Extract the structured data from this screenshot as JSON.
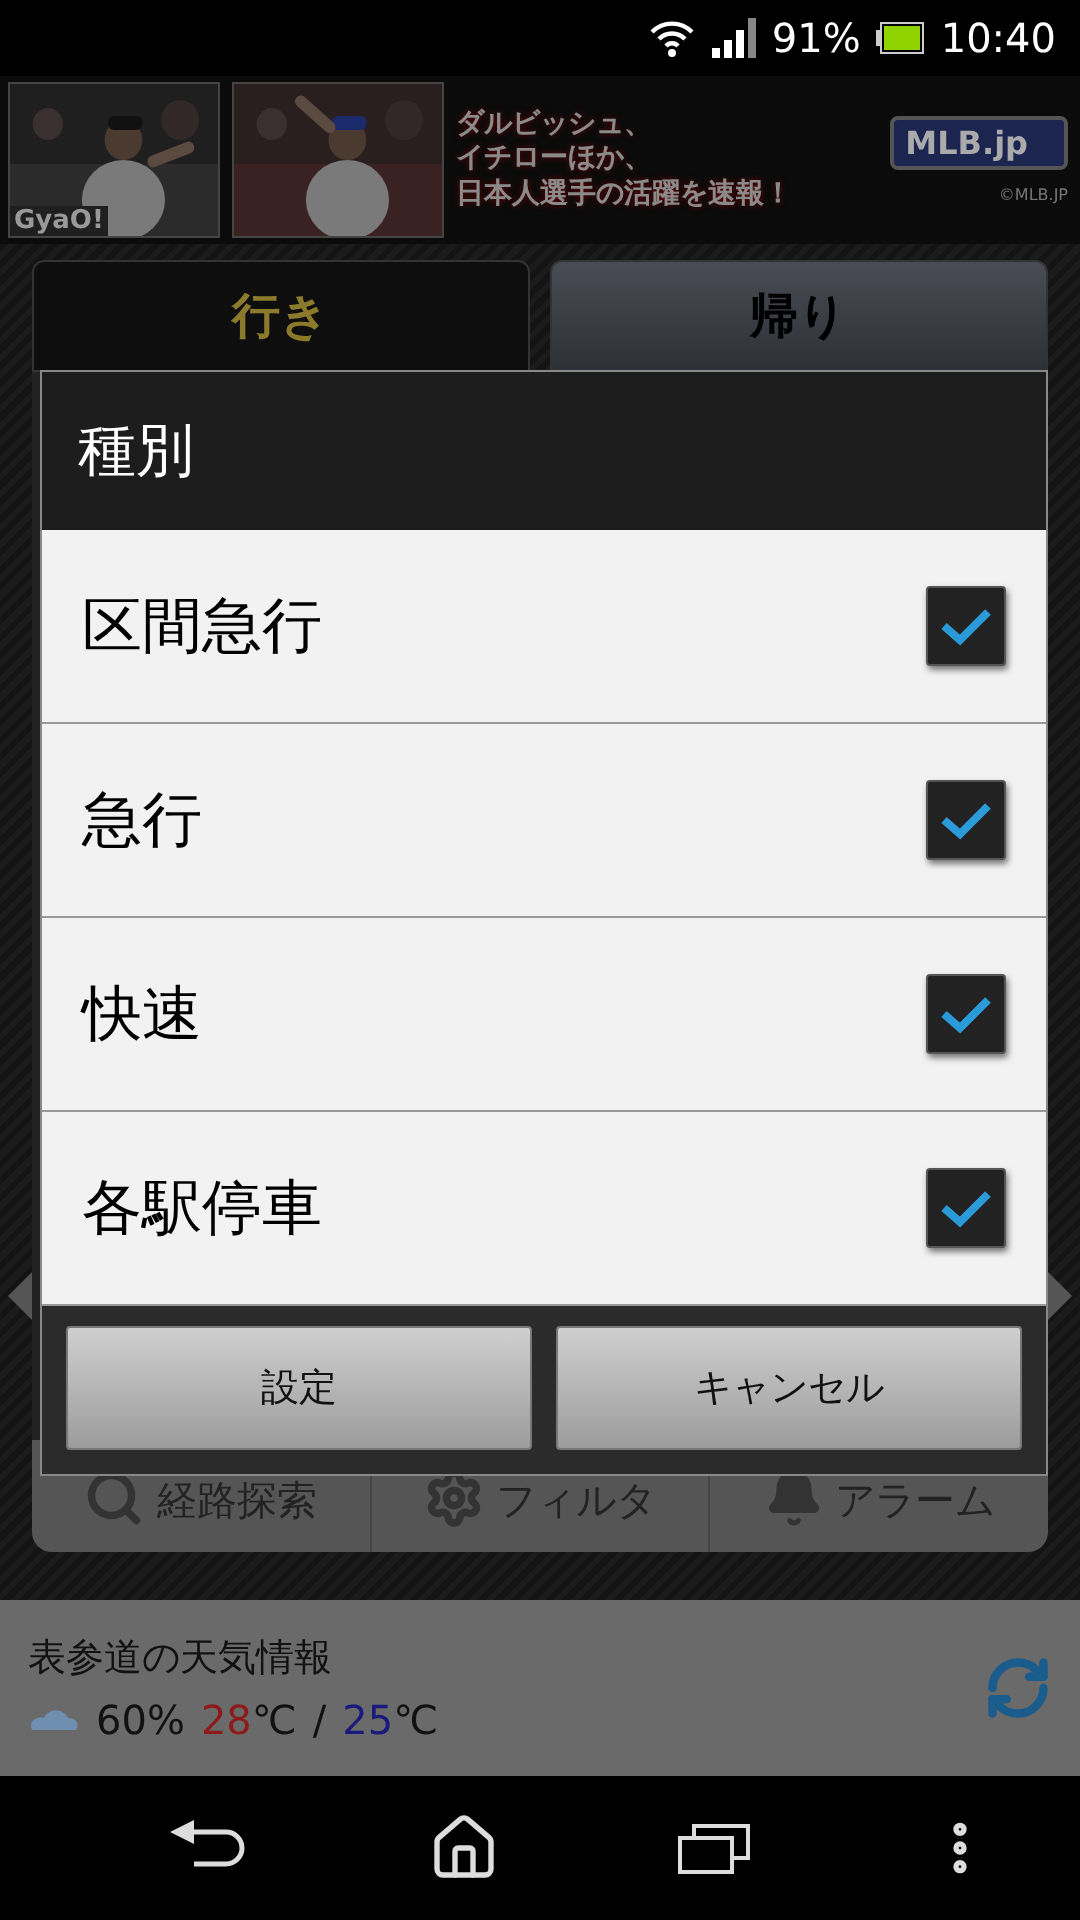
{
  "status_bar": {
    "battery_percent": "91%",
    "time": "10:40"
  },
  "ad_banner": {
    "brand": "GyaO!",
    "headline": [
      "ダルビッシュ、",
      "イチローほか、",
      "日本人選手の活躍を速報！"
    ],
    "logo": "MLB.jp",
    "copyright": "©MLB.JP"
  },
  "tabs": [
    {
      "label": "行き",
      "selected": false
    },
    {
      "label": "帰り",
      "selected": true
    }
  ],
  "toolbar": [
    {
      "label": "経路探索",
      "kind": "search"
    },
    {
      "label": "フィルタ",
      "kind": "filter"
    },
    {
      "label": "アラーム",
      "kind": "alarm"
    }
  ],
  "weather": {
    "title": "表参道の天気情報",
    "precipitation": "60%",
    "temps": [
      {
        "value": "28",
        "unit": "℃",
        "kind": "high"
      },
      {
        "value": "25",
        "unit": "℃",
        "kind": "low"
      }
    ],
    "separator": "/"
  },
  "dialog": {
    "title": "種別",
    "options": [
      {
        "label": "区間急行",
        "checked": true
      },
      {
        "label": "急行",
        "checked": true
      },
      {
        "label": "快速",
        "checked": true
      },
      {
        "label": "各駅停車",
        "checked": true
      }
    ],
    "buttons": [
      "設定",
      "キャンセル"
    ]
  }
}
